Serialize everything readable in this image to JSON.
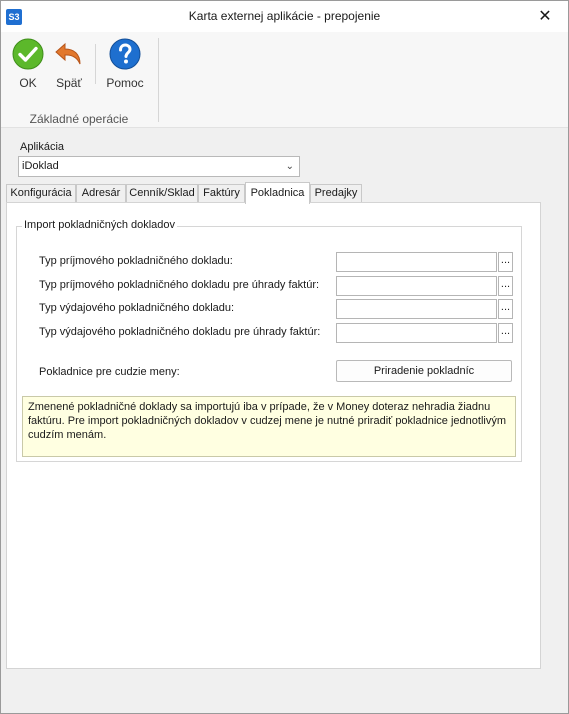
{
  "window": {
    "title": "Karta externej aplikácie - prepojenie",
    "app_icon_text": "S3",
    "close_glyph": "✕"
  },
  "ribbon": {
    "ok_label": "OK",
    "back_label": "Späť",
    "help_label": "Pomoc",
    "group_label": "Základné operácie",
    "icons": [
      "ok-check-icon",
      "undo-arrow-icon",
      "help-question-icon"
    ],
    "colors": {
      "ok": "#5cb82b",
      "back": "#e2782d",
      "help": "#1e6fcf"
    }
  },
  "application": {
    "label": "Aplikácia",
    "selected": "iDoklad"
  },
  "tabs": [
    {
      "label": "Konfigurácia"
    },
    {
      "label": "Adresár"
    },
    {
      "label": "Cenník/Sklad"
    },
    {
      "label": "Faktúry"
    },
    {
      "label": "Pokladnica",
      "active": true
    },
    {
      "label": "Predajky"
    }
  ],
  "import_group": {
    "title": "Import pokladničných dokladov",
    "fields": [
      {
        "label": "Typ príjmového pokladničného dokladu:",
        "value": ""
      },
      {
        "label": "Typ príjmového pokladničného dokladu pre úhrady faktúr:",
        "value": ""
      },
      {
        "label": "Typ výdajového pokladničného dokladu:",
        "value": ""
      },
      {
        "label": "Typ výdajového pokladničného dokladu pre úhrady faktúr:",
        "value": ""
      }
    ],
    "browse_glyph": "...",
    "foreign_currency_label": "Pokladnice pre cudzie meny:",
    "assign_button_label": "Priradenie pokladníc",
    "note": "Zmenené pokladničné doklady sa importujú iba v prípade, že v Money doteraz nehradia žiadnu faktúru. Pre import pokladničných dokladov v cudzej mene je nutné priradiť pokladnice jednotlivým cudzím menám."
  }
}
